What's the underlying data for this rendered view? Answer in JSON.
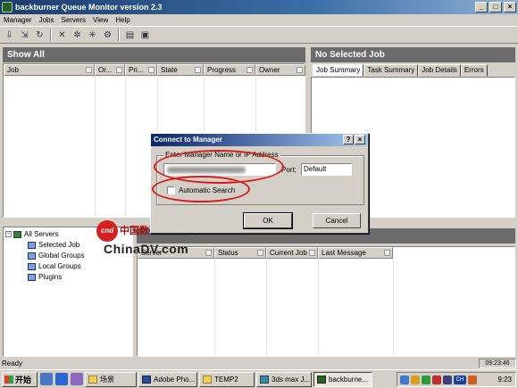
{
  "window": {
    "title": "backburner Queue Monitor version 2.3",
    "controls": [
      "_",
      "□",
      "×"
    ]
  },
  "menu": [
    "Manager",
    "Jobs",
    "Servers",
    "View",
    "Help"
  ],
  "toolbar": [
    "connect-icon",
    "disconnect-icon",
    "refresh-icon",
    "delete-icon",
    "server-assign-icon",
    "server-remove-icon",
    "settings-icon",
    "report-icon",
    "export-icon"
  ],
  "jobs_panel": {
    "title": "Show All",
    "columns": [
      "Job",
      "Or...",
      "Pri...",
      "State",
      "Progress",
      "Owner"
    ]
  },
  "job_info_panel": {
    "title": "No Selected Job",
    "tabs": [
      "Job Summary",
      "Task Summary",
      "Job Details",
      "Errors"
    ]
  },
  "servers_panel": {
    "columns": [
      "Server",
      "Status",
      "Current Job",
      "Last Message"
    ],
    "tree": {
      "root": "All Servers",
      "children": [
        "Selected Job",
        "Global Groups",
        "Local Groups",
        "Plugins"
      ]
    }
  },
  "watermark": {
    "cn": "中国数码视频在线",
    "en": "ChinaDV.com",
    "badge": "cnd"
  },
  "dialog": {
    "title": "Connect to Manager",
    "help": "?",
    "close": "×",
    "group_label": "Enter Manager Name or IP Address",
    "address_value": "",
    "port_label": "Port:",
    "port_value": "Default",
    "auto_search_label": "Automatic Search",
    "auto_search_checked": false,
    "ok": "OK",
    "cancel": "Cancel"
  },
  "annotation_color": "#d81c1c",
  "status": {
    "text": "Ready",
    "time": "09:23:46"
  },
  "taskbar": {
    "start": "开始",
    "tasks": [
      "场景",
      "Adobe Pho...",
      "TEMP2",
      "3ds max J...",
      "backburne..."
    ],
    "active_task": "backburne...",
    "clock": "9:23",
    "tray": [
      "CH"
    ]
  }
}
